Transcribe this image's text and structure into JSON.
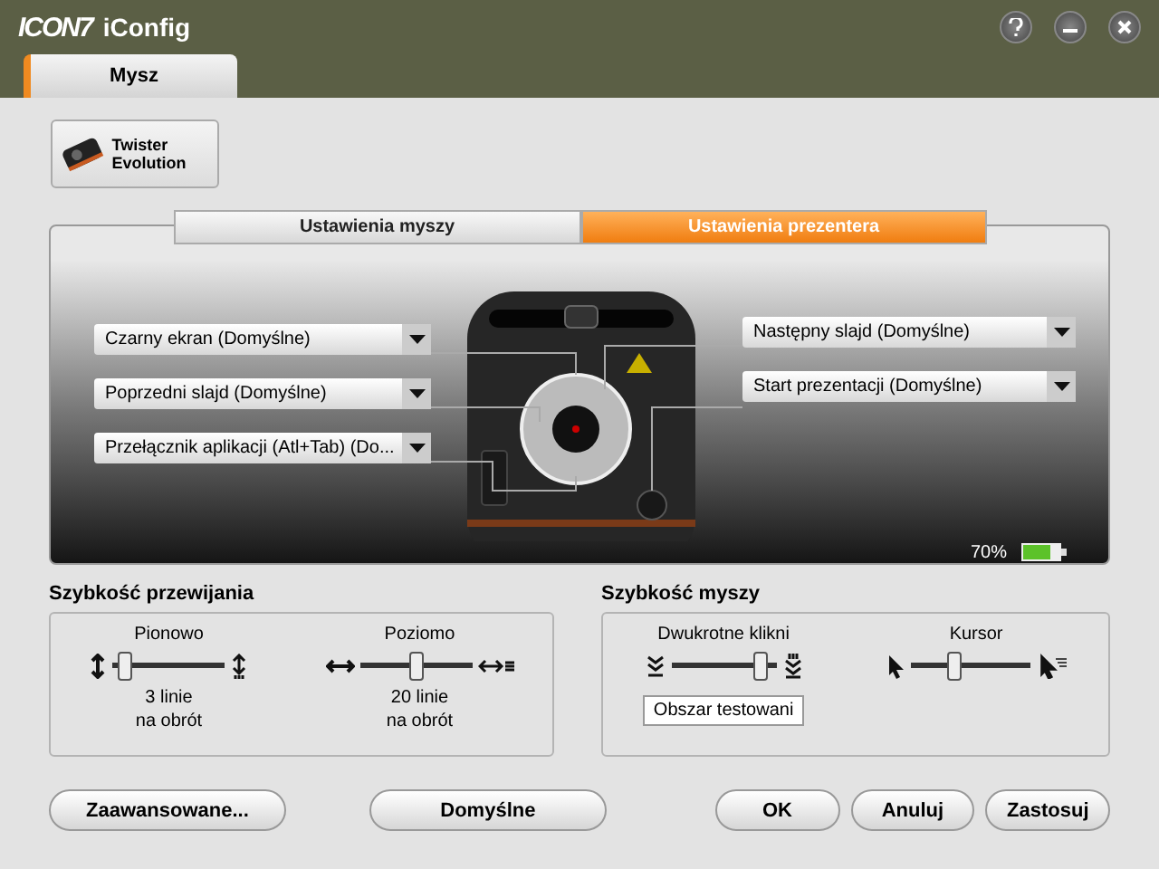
{
  "window": {
    "title": "iConfig",
    "logo": "ICON7"
  },
  "tabs": [
    {
      "label": "Mysz",
      "selected": true
    }
  ],
  "device": {
    "label": "Twister Evolution"
  },
  "mode_tabs": [
    {
      "label": "Ustawienia myszy",
      "selected": false
    },
    {
      "label": "Ustawienia prezentera",
      "selected": true
    }
  ],
  "left_dropdowns": [
    {
      "value": "Czarny ekran (Domyślne)"
    },
    {
      "value": "Poprzedni slajd (Domyślne)"
    },
    {
      "value": "Przełącznik aplikacji (Atl+Tab) (Do..."
    }
  ],
  "right_dropdowns": [
    {
      "value": "Następny slajd (Domyślne)"
    },
    {
      "value": "Start prezentacji (Domyślne)"
    }
  ],
  "battery": {
    "reading": "70%"
  },
  "scroll_speed": {
    "title": "Szybkość przewijania",
    "sliders": [
      {
        "label": "Pionowo",
        "kind": "vertical",
        "level": 0.05,
        "reading": [
          "3 linie",
          "na obrót"
        ]
      },
      {
        "label": "Poziomo",
        "kind": "horizontal",
        "level": 0.5,
        "reading": [
          "20 linie",
          "na obrót"
        ]
      }
    ]
  },
  "mouse_speed": {
    "title": "Szybkość myszy",
    "sliders": [
      {
        "label": "Dwukrotne klikni",
        "kind": "doubleclick",
        "level": 0.9
      },
      {
        "label": "Kursor",
        "kind": "cursor",
        "level": 0.35
      }
    ],
    "test_area": "Obszar testowani"
  },
  "buttons_left": [
    "Zaawansowane...",
    "Domyślne"
  ],
  "buttons_right": [
    "OK",
    "Anuluj",
    "Zastosuj"
  ]
}
